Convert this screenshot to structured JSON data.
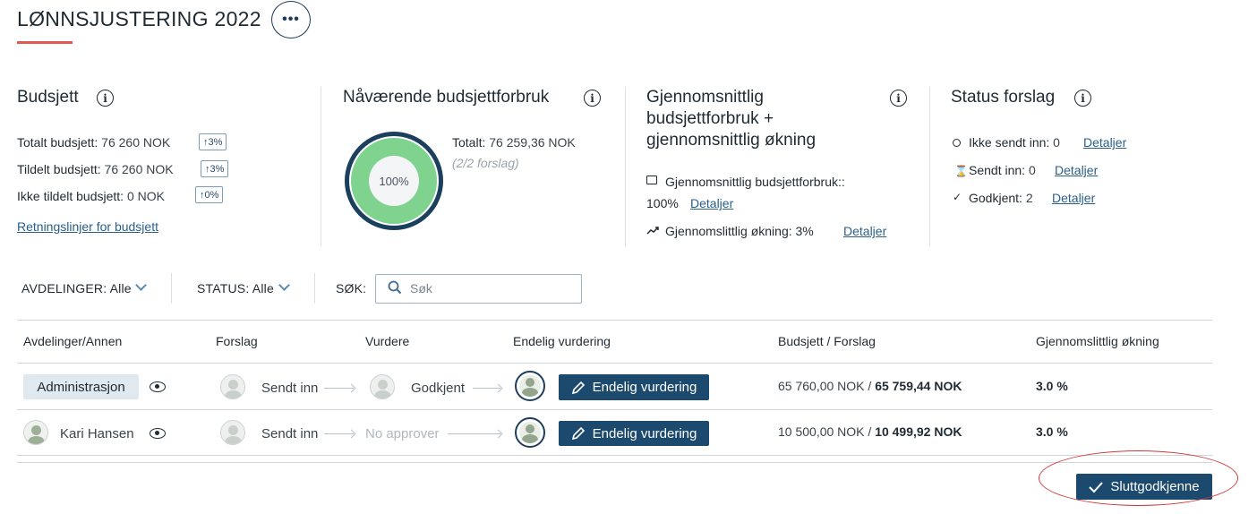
{
  "header": {
    "title": "LØNNSJUSTERING 2022",
    "more_label": "•••"
  },
  "budget_card": {
    "title": "Budsjett",
    "rows": [
      {
        "label": "Totalt budsjett:",
        "value": "76 260 NOK",
        "badge": "3%"
      },
      {
        "label": "Tildelt budsjett:",
        "value": "76 260 NOK",
        "badge": "3%"
      },
      {
        "label": "Ikke tildelt budsjett:",
        "value": "0 NOK",
        "badge": "0%"
      }
    ],
    "guidelines_link": "Retningslinjer for budsjett"
  },
  "usage_card": {
    "title": "Nåværende budsjettforbruk",
    "donut_label": "100%",
    "donut_fraction": 1.0,
    "total_label": "Totalt:",
    "total_value": "76 259,36 NOK",
    "proposals_note": "(2/2 forslag)"
  },
  "average_card": {
    "title_line1": "Gjennomsnittlig",
    "title_line2": "budsjettforbruk +",
    "title_line3": "gjennomsnittlig økning",
    "usage_label": "Gjennomsnittlig budsjettforbruk::",
    "usage_value": "100%",
    "increase_label": "Gjennomslittlig økning:",
    "increase_value": "3%",
    "details": "Detaljer"
  },
  "status_card": {
    "title": "Status forslag",
    "items": [
      {
        "label": "Ikke sendt inn:",
        "count": "0",
        "link": "Detaljer"
      },
      {
        "label": "Sendt inn:",
        "count": "0",
        "link": "Detaljer"
      },
      {
        "label": "Godkjent:",
        "count": "2",
        "link": "Detaljer"
      }
    ]
  },
  "filters": {
    "departments_label": "AVDELINGER:",
    "departments_value": "Alle",
    "status_label": "STATUS:",
    "status_value": "Alle",
    "search_label": "SØK:",
    "search_placeholder": "Søk"
  },
  "table": {
    "headers": [
      "Avdelinger/Annen",
      "Forslag",
      "Vurdere",
      "Endelig vurdering",
      "Budsjett / Forslag",
      "Gjennomslittlig økning"
    ],
    "rows": [
      {
        "name": "Administrasjon",
        "proposal": "Sendt inn",
        "review": "Godkjent",
        "final_button": "Endelig vurdering",
        "budget": "65 760,00 NOK",
        "proposal_amount": "65 759,44 NOK",
        "increase": "3.0 %"
      },
      {
        "name": "Kari Hansen",
        "proposal": "Sendt inn",
        "review": "No approver",
        "final_button": "Endelig vurdering",
        "budget": "10 500,00 NOK",
        "proposal_amount": "10 499,92 NOK",
        "increase": "3.0 %"
      }
    ]
  },
  "footer": {
    "final_approve": "Sluttgodkjenne"
  },
  "colors": {
    "primary": "#1c4a6e",
    "accent": "#e0584f",
    "donut": "#7fd38f",
    "highlight": "#d0393a"
  }
}
